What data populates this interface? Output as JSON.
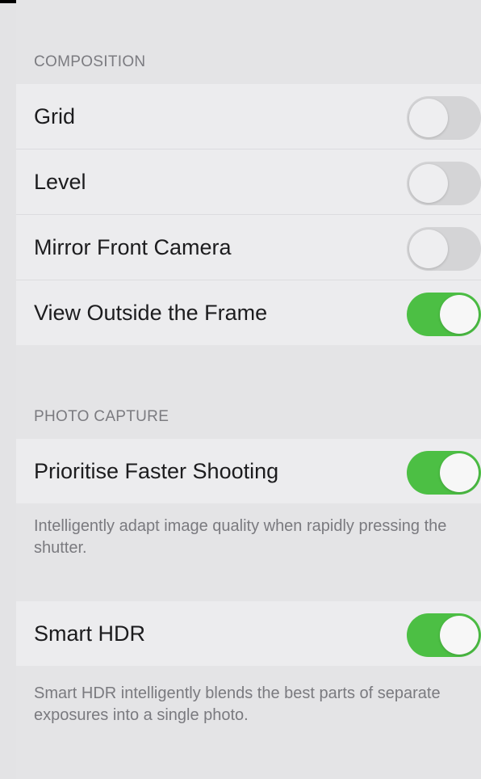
{
  "composition": {
    "header": "COMPOSITION",
    "rows": [
      {
        "label": "Grid",
        "on": false
      },
      {
        "label": "Level",
        "on": false
      },
      {
        "label": "Mirror Front Camera",
        "on": false
      },
      {
        "label": "View Outside the Frame",
        "on": true
      }
    ]
  },
  "photo_capture": {
    "header": "PHOTO CAPTURE",
    "faster_shooting": {
      "label": "Prioritise Faster Shooting",
      "on": true
    },
    "faster_shooting_note": "Intelligently adapt image quality when rapidly pressing the shutter.",
    "smart_hdr": {
      "label": "Smart HDR",
      "on": true
    },
    "smart_hdr_note": "Smart HDR intelligently blends the best parts of separate exposures into a single photo."
  },
  "colors": {
    "toggle_on": "#4cbf44",
    "toggle_off": "#d4d4d6",
    "background": "#e4e4e6"
  }
}
